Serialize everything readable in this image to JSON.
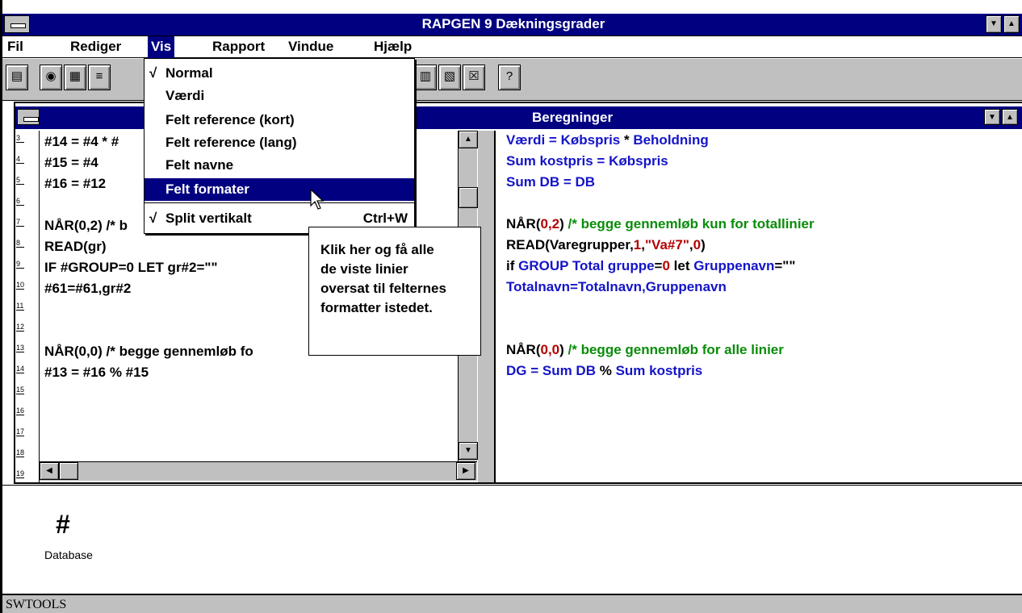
{
  "window": {
    "title": "RAPGEN 9 Dækningsgrader"
  },
  "menu": {
    "items": [
      "Fil",
      "Rediger",
      "Vis",
      "Rapport",
      "Vindue",
      "Hjælp"
    ],
    "active": "Vis"
  },
  "dropdown": {
    "items": [
      {
        "label": "Normal",
        "checked": true
      },
      {
        "label": "Værdi",
        "checked": false
      },
      {
        "label": "Felt reference (kort)",
        "checked": false
      },
      {
        "label": "Felt reference (lang)",
        "checked": false
      },
      {
        "label": "Felt navne",
        "checked": false
      },
      {
        "label": "Felt formater",
        "checked": false,
        "selected": true
      },
      {
        "label": "Split vertikalt",
        "checked": true,
        "accelerator": "Ctrl+W"
      }
    ]
  },
  "child_window": {
    "title": "Beregninger"
  },
  "left_pane": {
    "line_numbers": [
      "3",
      "4",
      "5",
      "6",
      "7",
      "8",
      "9",
      "10",
      "11",
      "12",
      "13",
      "14",
      "15",
      "16",
      "17",
      "18",
      "19"
    ],
    "lines": [
      "#14 = #4 * #",
      "#15 = #4",
      "#16 = #12",
      "",
      "NÅR(0,2) /* b",
      "READ(gr)",
      "IF #GROUP=0 LET gr#2=\"\"",
      "#61=#61,gr#2",
      "",
      "",
      "NÅR(0,0) /* begge gennemløb fo",
      "#13 = #16 % #15"
    ]
  },
  "right_pane": {
    "lines": [
      [
        {
          "t": "Værdi",
          "c": "id"
        },
        {
          "t": " = ",
          "c": "id"
        },
        {
          "t": "Købspris",
          "c": "id"
        },
        {
          "t": " * ",
          "c": "kw"
        },
        {
          "t": "Beholdning",
          "c": "id"
        }
      ],
      [
        {
          "t": "Sum kostpris",
          "c": "id"
        },
        {
          "t": " = ",
          "c": "id"
        },
        {
          "t": "Købspris",
          "c": "id"
        }
      ],
      [
        {
          "t": "Sum DB",
          "c": "id"
        },
        {
          "t": " = ",
          "c": "id"
        },
        {
          "t": "DB",
          "c": "id"
        }
      ],
      [],
      [
        {
          "t": "NÅR(",
          "c": "kw"
        },
        {
          "t": "0,2",
          "c": "num"
        },
        {
          "t": ") ",
          "c": "kw"
        },
        {
          "t": "/* begge gennemløb kun for totallinier",
          "c": "com"
        }
      ],
      [
        {
          "t": "READ(",
          "c": "kw"
        },
        {
          "t": "Varegrupper",
          "c": "kw"
        },
        {
          "t": ",",
          "c": "kw"
        },
        {
          "t": "1",
          "c": "num"
        },
        {
          "t": ",",
          "c": "kw"
        },
        {
          "t": "\"Va#7\"",
          "c": "str"
        },
        {
          "t": ",",
          "c": "kw"
        },
        {
          "t": "0",
          "c": "num"
        },
        {
          "t": ")",
          "c": "kw"
        }
      ],
      [
        {
          "t": "if ",
          "c": "kw"
        },
        {
          "t": "GROUP Total gruppe",
          "c": "id"
        },
        {
          "t": "=",
          "c": "kw"
        },
        {
          "t": "0",
          "c": "num"
        },
        {
          "t": " let ",
          "c": "kw"
        },
        {
          "t": "Gruppenavn",
          "c": "id"
        },
        {
          "t": "=\"\"",
          "c": "kw"
        }
      ],
      [
        {
          "t": "Totalnavn",
          "c": "id"
        },
        {
          "t": "=",
          "c": "id"
        },
        {
          "t": "Totalnavn",
          "c": "id"
        },
        {
          "t": ",",
          "c": "id"
        },
        {
          "t": "Gruppenavn",
          "c": "id"
        }
      ],
      [],
      [],
      [
        {
          "t": "NÅR(",
          "c": "kw"
        },
        {
          "t": "0,0",
          "c": "num"
        },
        {
          "t": ") ",
          "c": "kw"
        },
        {
          "t": "/* begge gennemløb for alle linier",
          "c": "com"
        }
      ],
      [
        {
          "t": "DG",
          "c": "id"
        },
        {
          "t": " = ",
          "c": "id"
        },
        {
          "t": "Sum DB",
          "c": "id"
        },
        {
          "t": " % ",
          "c": "kw"
        },
        {
          "t": "Sum kostpris",
          "c": "id"
        }
      ]
    ]
  },
  "tooltip": {
    "lines": [
      "Klik her og få alle",
      "de viste linier",
      "oversat til felternes",
      "formatter istedet."
    ]
  },
  "desktop_icon": {
    "label": "Database",
    "icon": "hash-icon"
  },
  "status": {
    "text": "SWTOOLS"
  },
  "colors": {
    "titlebar": "#000080",
    "identifier": "#1414c8",
    "number": "#b40000",
    "comment": "#0a8c0a",
    "chrome": "#c0c0c0"
  }
}
